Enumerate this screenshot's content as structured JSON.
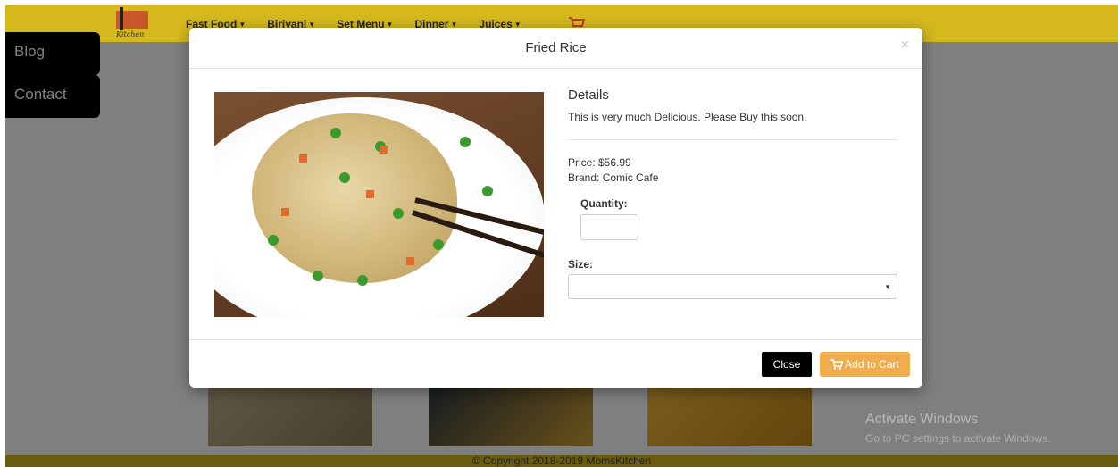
{
  "navbar": {
    "logo_text_top": "Moms",
    "logo_text_bottom": "Kitchen",
    "items": [
      {
        "label": "Fast Food"
      },
      {
        "label": "Biriyani"
      },
      {
        "label": "Set Menu"
      },
      {
        "label": "Dinner"
      },
      {
        "label": "Juices"
      }
    ],
    "cart_icon": "shopping-cart-icon"
  },
  "sidebar": {
    "items": [
      {
        "label": "Blog"
      },
      {
        "label": "Contact"
      }
    ]
  },
  "modal": {
    "title": "Fried Rice",
    "close_symbol": "×",
    "details_heading": "Details",
    "description": "This is very much Delicious. Please Buy this soon.",
    "price": "Price: $56.99",
    "brand": "Brand: Comic Cafe",
    "quantity_label": "Quantity:",
    "quantity_value": "",
    "size_label": "Size:",
    "size_value": "",
    "close_button": "Close",
    "add_to_cart_button": "Add to Cart"
  },
  "footer": {
    "copyright": "© Copyright 2018-2019 MomsKitchen"
  },
  "watermark": {
    "title": "Activate Windows",
    "subtitle": "Go to PC settings to activate Windows."
  },
  "colors": {
    "navbar": "#d4b81c",
    "accent_button": "#f0ad4e",
    "dark_button": "#000000"
  }
}
